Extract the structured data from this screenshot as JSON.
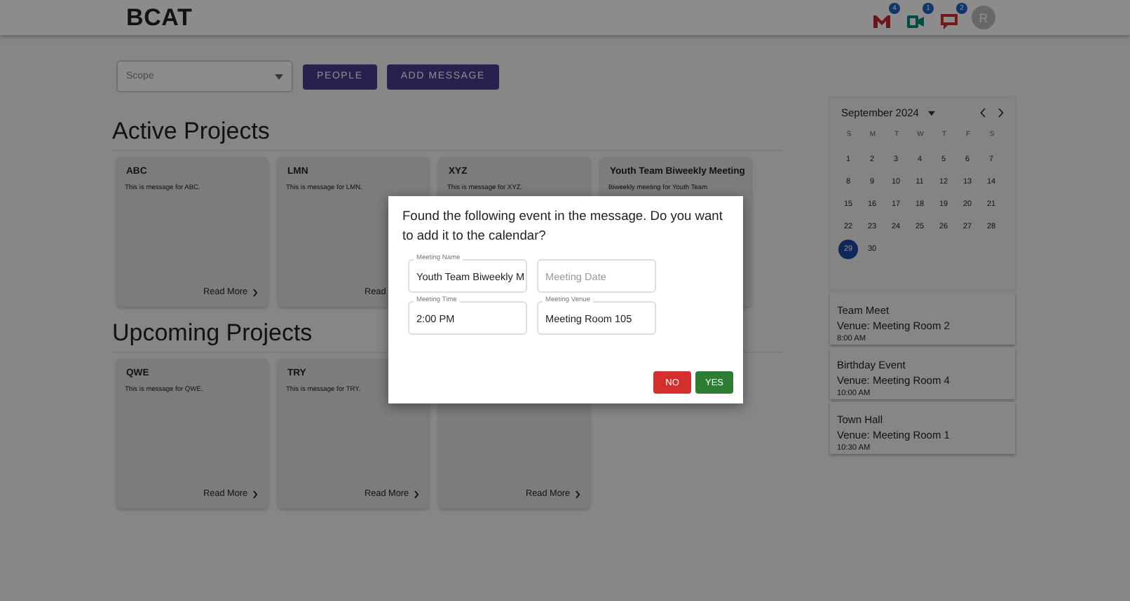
{
  "header": {
    "logo": "BCAT",
    "icons": [
      {
        "kind": "mail",
        "badge": "4"
      },
      {
        "kind": "video",
        "badge": "1"
      },
      {
        "kind": "chat",
        "badge": "2"
      }
    ],
    "avatar": {
      "initial": "R"
    }
  },
  "toolbar": {
    "scope": {
      "placeholder": "Scope"
    },
    "buttons": [
      "PEOPLE",
      "ADD MESSAGE"
    ]
  },
  "sections": [
    {
      "title": "Active Projects",
      "cards": [
        {
          "title": "ABC",
          "message": "This is message for ABC.",
          "read_more": "Read More"
        },
        {
          "title": "LMN",
          "message": "This is message for LMN.",
          "read_more": "Read"
        },
        {
          "title": "XYZ",
          "message": "This is message for XYZ."
        },
        {
          "title": "Youth Team Biweekly Meeting",
          "message": "Biweekly meeting for Youth Team"
        }
      ]
    },
    {
      "title": "Upcoming Projects",
      "cards": [
        {
          "title": "QWE",
          "message": "This is message for QWE.",
          "read_more": "Read More"
        },
        {
          "title": "TRY",
          "message": "This is message for TRY.",
          "read_more": "Read More"
        },
        {
          "read_more": "Read More"
        }
      ]
    }
  ],
  "calendar": {
    "month": "September 2024",
    "weekdays": [
      "S",
      "M",
      "T",
      "W",
      "T",
      "F",
      "S"
    ],
    "weeks": [
      [
        {
          "day": "1",
          "selected": false
        },
        {
          "day": "2",
          "selected": false
        },
        {
          "day": "3",
          "selected": false
        },
        {
          "day": "4",
          "selected": false
        },
        {
          "day": "5",
          "selected": false
        },
        {
          "day": "6",
          "selected": false
        },
        {
          "day": "7",
          "selected": false
        }
      ],
      [
        {
          "day": "8",
          "selected": false
        },
        {
          "day": "9",
          "selected": false
        },
        {
          "day": "10",
          "selected": false
        },
        {
          "day": "11",
          "selected": false
        },
        {
          "day": "12",
          "selected": false
        },
        {
          "day": "13",
          "selected": false
        },
        {
          "day": "14",
          "selected": false
        }
      ],
      [
        {
          "day": "15",
          "selected": false
        },
        {
          "day": "16",
          "selected": false
        },
        {
          "day": "17",
          "selected": false
        },
        {
          "day": "18",
          "selected": false
        },
        {
          "day": "19",
          "selected": false
        },
        {
          "day": "20",
          "selected": false
        },
        {
          "day": "21",
          "selected": false
        }
      ],
      [
        {
          "day": "22",
          "selected": false
        },
        {
          "day": "23",
          "selected": false
        },
        {
          "day": "24",
          "selected": false
        },
        {
          "day": "25",
          "selected": false
        },
        {
          "day": "26",
          "selected": false
        },
        {
          "day": "27",
          "selected": false
        },
        {
          "day": "28",
          "selected": false
        }
      ],
      [
        {
          "day": "29",
          "selected": true
        },
        {
          "day": "30",
          "selected": false
        }
      ]
    ]
  },
  "events": [
    {
      "title": "Team Meet",
      "venue": "Venue: Meeting Room 2",
      "time": "8:00 AM"
    },
    {
      "title": "Birthday Event",
      "venue": "Venue: Meeting Room 4",
      "time": "10:00 AM"
    },
    {
      "title": "Town Hall",
      "venue": "Venue: Meeting Room 1",
      "time": "10:30 AM"
    }
  ],
  "dialog": {
    "message": "Found the following event in the message. Do you want to add it to the calendar?",
    "fields": [
      {
        "label": "Meeting Name",
        "value": "Youth Team Biweekly M"
      },
      {
        "placeholder": "Meeting Date"
      },
      {
        "label": "Meeting Time",
        "value": "2:00 PM"
      },
      {
        "label": "Meeting Venue",
        "value": "Meeting Room 105"
      }
    ],
    "buttons": [
      {
        "label": "NO",
        "kind": "decline"
      },
      {
        "label": "YES",
        "kind": "confirm"
      }
    ]
  }
}
